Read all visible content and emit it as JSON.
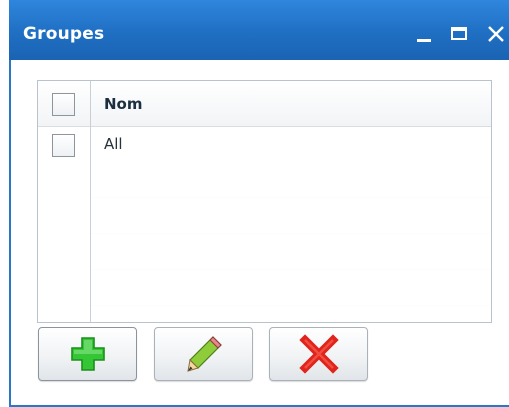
{
  "window": {
    "title": "Groupes",
    "controls": {
      "minimize": "minimize-icon",
      "maximize": "maximize-icon",
      "close": "close-icon"
    }
  },
  "grid": {
    "columns": [
      {
        "label": "Nom"
      }
    ],
    "rows": [
      {
        "nom": "All",
        "checked": false
      }
    ],
    "select_all_checked": false
  },
  "toolbar": {
    "add_icon": "plus-icon",
    "edit_icon": "pencil-icon",
    "delete_icon": "red-x-icon"
  },
  "colors": {
    "titlebar": "#1f6fc3",
    "add": "#2fbf2f",
    "delete": "#e0241b"
  }
}
